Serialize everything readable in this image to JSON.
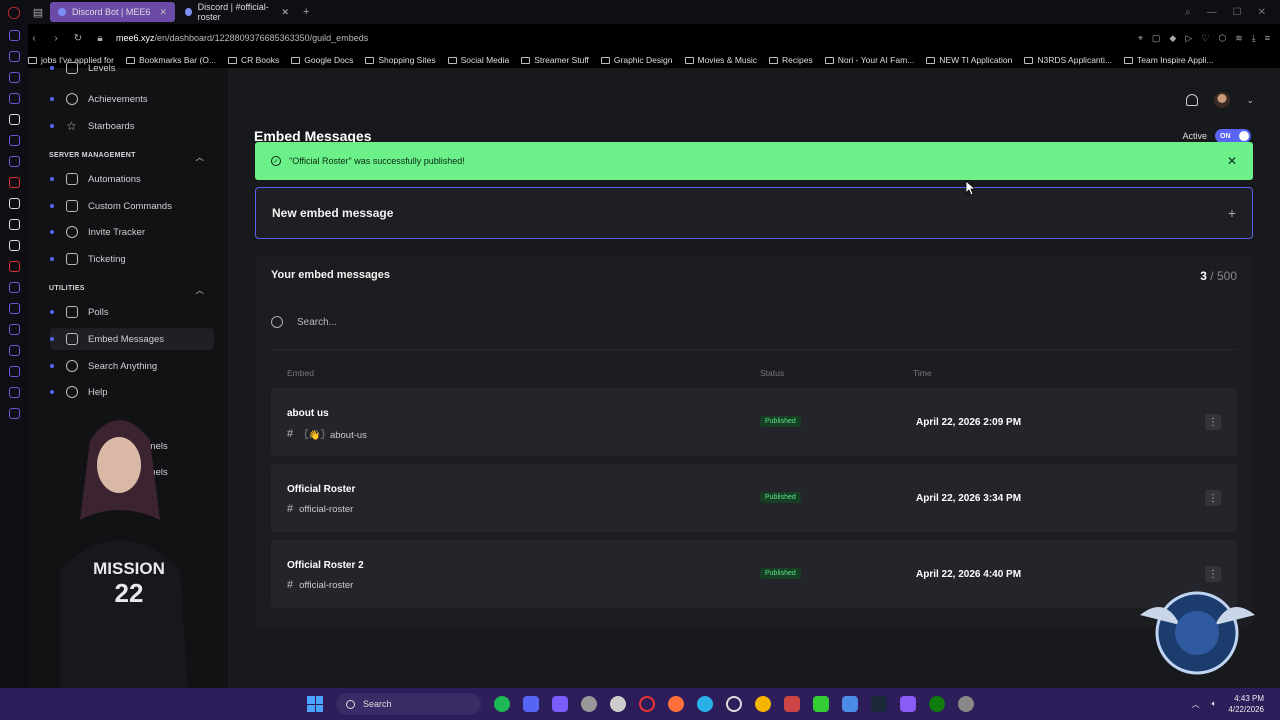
{
  "browser": {
    "tabs": [
      {
        "label": "Discord Bot | MEE6",
        "active": true
      },
      {
        "label": "Discord | #official-roster",
        "active": false
      }
    ],
    "url_domain": "mee6.xyz",
    "url_path": "/en/dashboard/1228809376685363350/guild_embeds",
    "bookmarks": [
      "jobs I've applied for",
      "Bookmarks Bar (O...",
      "CR Books",
      "Google Docs",
      "Shopping Sites",
      "Social Media",
      "Streamer Stuff",
      "Graphic Design",
      "Movies & Music",
      "Recipes",
      "Nori - Your AI Fam...",
      "NEW TI Application",
      "N3RDS Applicanti...",
      "Team Inspire Appli..."
    ]
  },
  "sidebar": {
    "items_top": [
      {
        "label": "Levels",
        "icon": "levels-icon"
      },
      {
        "label": "Achievements",
        "icon": "achievements-icon"
      },
      {
        "label": "Starboards",
        "icon": "star-icon"
      }
    ],
    "section_server": "SERVER MANAGEMENT",
    "server_items": [
      {
        "label": "Automations",
        "icon": "automations-icon"
      },
      {
        "label": "Custom Commands",
        "icon": "commands-icon"
      },
      {
        "label": "Invite Tracker",
        "icon": "invite-icon"
      },
      {
        "label": "Ticketing",
        "icon": "ticket-icon"
      }
    ],
    "section_utilities": "UTILITIES",
    "utility_items": [
      {
        "label": "Polls",
        "icon": "polls-icon"
      },
      {
        "label": "Embed Messages",
        "icon": "embed-icon"
      },
      {
        "label": "Search Anything",
        "icon": "search-anything-icon"
      },
      {
        "label": "Help",
        "icon": "help-icon"
      }
    ],
    "partial_items": [
      "nnels",
      "nnels"
    ]
  },
  "page": {
    "title": "Embed Messages",
    "active_label": "Active",
    "toggle_label": "ON"
  },
  "toast": {
    "message": "\"Official Roster\" was successfully published!"
  },
  "new_embed": {
    "label": "New embed message"
  },
  "list": {
    "heading": "Your embed messages",
    "count_used": "3",
    "count_total": "/ 500",
    "search_placeholder": "Search...",
    "columns": [
      "Embed",
      "Status",
      "Time"
    ],
    "rows": [
      {
        "name": "about us",
        "channel": "〖👋〗about-us",
        "status": "Published",
        "time": "April 22, 2026 2:09 PM"
      },
      {
        "name": "Official Roster",
        "channel": "official-roster",
        "status": "Published",
        "time": "April 22, 2026 3:34 PM"
      },
      {
        "name": "Official Roster 2",
        "channel": "official-roster",
        "status": "Published",
        "time": "April 22, 2026 4:40 PM"
      }
    ]
  },
  "overlay": {
    "shirt_text": "MISSION",
    "shirt_number": "22"
  },
  "taskbar": {
    "search_label": "Search",
    "time": "4:43 PM",
    "date": "4/22/2026"
  }
}
